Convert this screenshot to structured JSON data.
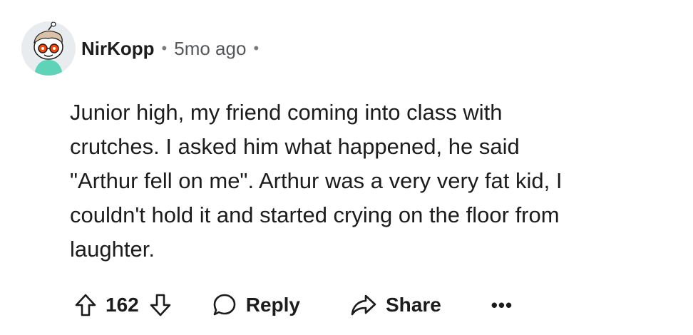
{
  "comment": {
    "author": "NirKopp",
    "separator": "•",
    "timestamp": "5mo ago",
    "trailing_separator": "•",
    "body": "Junior high, my friend coming into class with\ncrutches. I asked him what happened, he said\n\"Arthur fell on me\". Arthur was a very very fat kid, I\ncouldn't hold it and started crying on the floor from\nlaughter."
  },
  "actions": {
    "upvote_icon": "arrow-up-outline-icon",
    "vote_count": "162",
    "downvote_icon": "arrow-down-outline-icon",
    "reply_icon": "speech-bubble-icon",
    "reply_label": "Reply",
    "share_icon": "share-arrow-icon",
    "share_label": "Share",
    "more_label": "•••"
  },
  "colors": {
    "text": "#1c1c1c",
    "muted": "#55575a",
    "background": "#ffffff",
    "avatar_bg": "#e9ecef"
  }
}
